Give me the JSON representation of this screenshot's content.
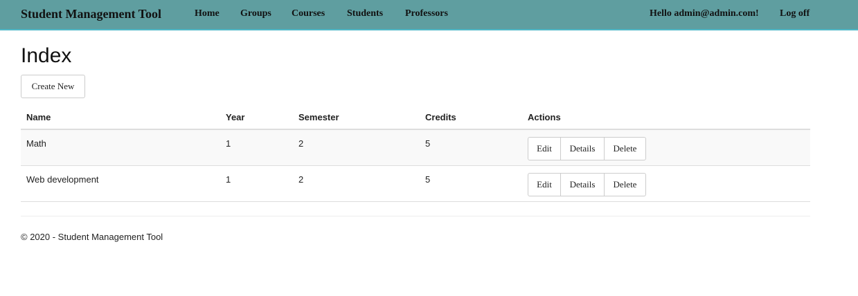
{
  "navbar": {
    "brand": "Student Management Tool",
    "links": [
      "Home",
      "Groups",
      "Courses",
      "Students",
      "Professors"
    ],
    "greeting": "Hello admin@admin.com!",
    "logoff": "Log off",
    "background": "#5f9ea0"
  },
  "page": {
    "title": "Index",
    "create_label": "Create New"
  },
  "table": {
    "headers": [
      "Name",
      "Year",
      "Semester",
      "Credits",
      "Actions"
    ],
    "rows": [
      {
        "name": "Math",
        "year": "1",
        "semester": "2",
        "credits": "5"
      },
      {
        "name": "Web development",
        "year": "1",
        "semester": "2",
        "credits": "5"
      }
    ],
    "actions": {
      "edit": "Edit",
      "details": "Details",
      "delete": "Delete"
    }
  },
  "footer": {
    "text": "© 2020 - Student Management Tool"
  }
}
